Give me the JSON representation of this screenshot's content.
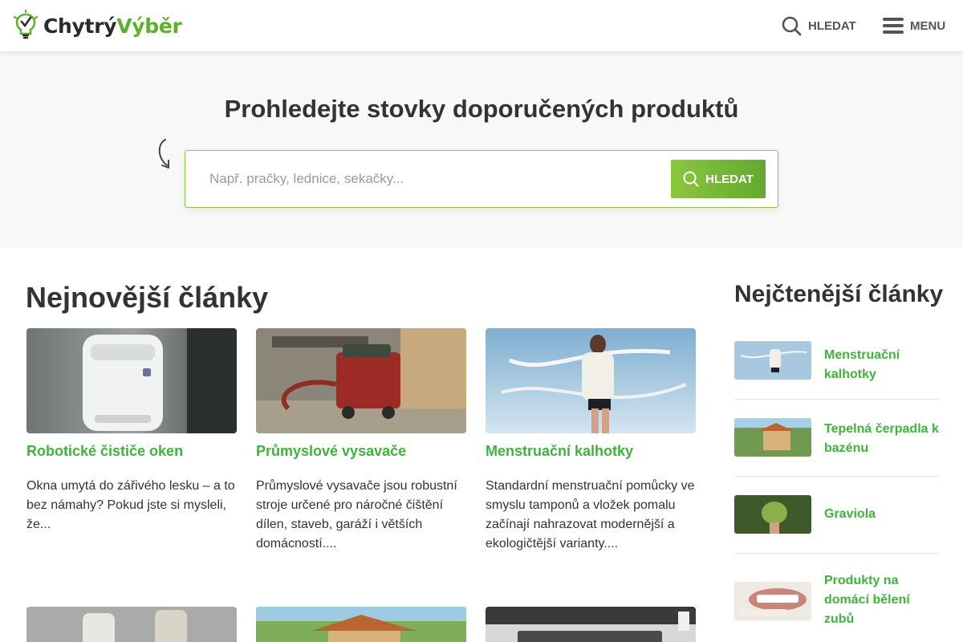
{
  "header": {
    "logo_part1": "Chytrý",
    "logo_part2": "Výběr",
    "search_label": "HLEDAT",
    "menu_label": "MENU"
  },
  "hero": {
    "title": "Prohledejte stovky doporučených produktů",
    "search_placeholder": "Např. pračky, lednice, sekačky...",
    "search_value": "",
    "search_button": "HLEDAT"
  },
  "newest": {
    "title": "Nejnovější články",
    "articles": [
      {
        "title": "Robotické čističe oken",
        "description": "Okna umytá do zářivého lesku – a to bez námahy? Pokud jste si mysleli, že..."
      },
      {
        "title": "Průmyslové vysavače",
        "description": "Průmyslové vysavače jsou robustní stroje určené pro náročné čištění dílen, staveb, garáží i větších domácností...."
      },
      {
        "title": "Menstruační kalhotky",
        "description": "Standardní menstruační pomůcky ve smyslu tamponů a vložek pomalu začínají nahrazovat modernější a ekologičtější varianty...."
      }
    ]
  },
  "popular": {
    "title": "Nejčtenější články",
    "items": [
      {
        "title": "Menstruační kalhotky"
      },
      {
        "title": "Tepelná čerpadla k bazénu"
      },
      {
        "title": "Graviola"
      },
      {
        "title": "Produkty na domácí bělení zubů"
      }
    ]
  },
  "colors": {
    "accent": "#3fb33a",
    "button": "#8cc63f",
    "text": "#333333"
  }
}
